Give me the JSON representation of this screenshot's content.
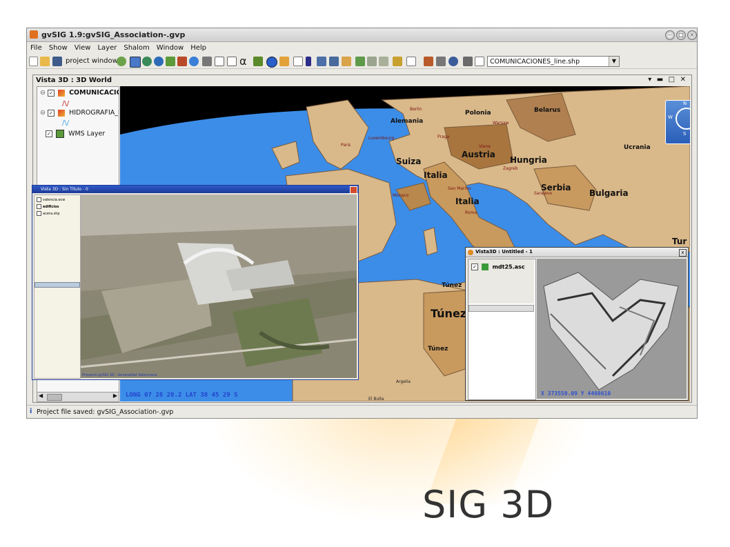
{
  "window": {
    "title": "gvSIG 1.9:gvSIG_Association-.gvp"
  },
  "menu": [
    "File",
    "Show",
    "View",
    "Layer",
    "Shalom",
    "Window",
    "Help"
  ],
  "toolbar": {
    "project_window_label": "project window",
    "alpha_glyph": "α",
    "layer_selector_value": "COMUNICACIONES_line.shp"
  },
  "view3d": {
    "title": "Vista 3D : 3D World",
    "controls": "▾ ▬ □ ✕",
    "layers": [
      {
        "name": "COMUNICACIO",
        "checked": true
      },
      {
        "name": "HIDROGRAFIA_l",
        "checked": true
      },
      {
        "name": "WMS Layer",
        "checked": true
      }
    ],
    "coords_readout": "LONG 07 28 28.2 LAT 38 45 29 S",
    "compass_labels": {
      "n": "N",
      "w": "W",
      "e": "E",
      "s": "S"
    },
    "country_labels": [
      "Alemania",
      "Polonia",
      "Belarus",
      "Ucrania",
      "Suiza",
      "Austria",
      "Hungria",
      "Italia",
      "Italia",
      "Serbia",
      "Bulgaria",
      "Túnez",
      "Túnez",
      "Túnez",
      "Tur"
    ],
    "city_labels": [
      "Paris",
      "Berlin",
      "Warsaw",
      "Praga",
      "Viena",
      "Roma",
      "San Marino",
      "Monaco",
      "Sarajevo",
      "Zagreb",
      "Luxembourg",
      "Argelia",
      "El Bulla"
    ]
  },
  "valencia_window": {
    "title": "Vista 3D : Sin Título - 0",
    "layers": [
      "valencia.ecw",
      "edificios",
      "acera.shp"
    ],
    "footer_text": "Proyecto gvSIG 3D · Generalitat Valenciana"
  },
  "mdt_window": {
    "title": "Vista3D : Untitled - 1",
    "close": "x",
    "layer_name": "mdt25.asc",
    "coords_readout": "X 373550.09 Y 4408610"
  },
  "status": {
    "text": "Project file saved: gvSIG_Association-.gvp",
    "icon": "info-icon"
  },
  "slide": {
    "title": "SIG 3D"
  }
}
